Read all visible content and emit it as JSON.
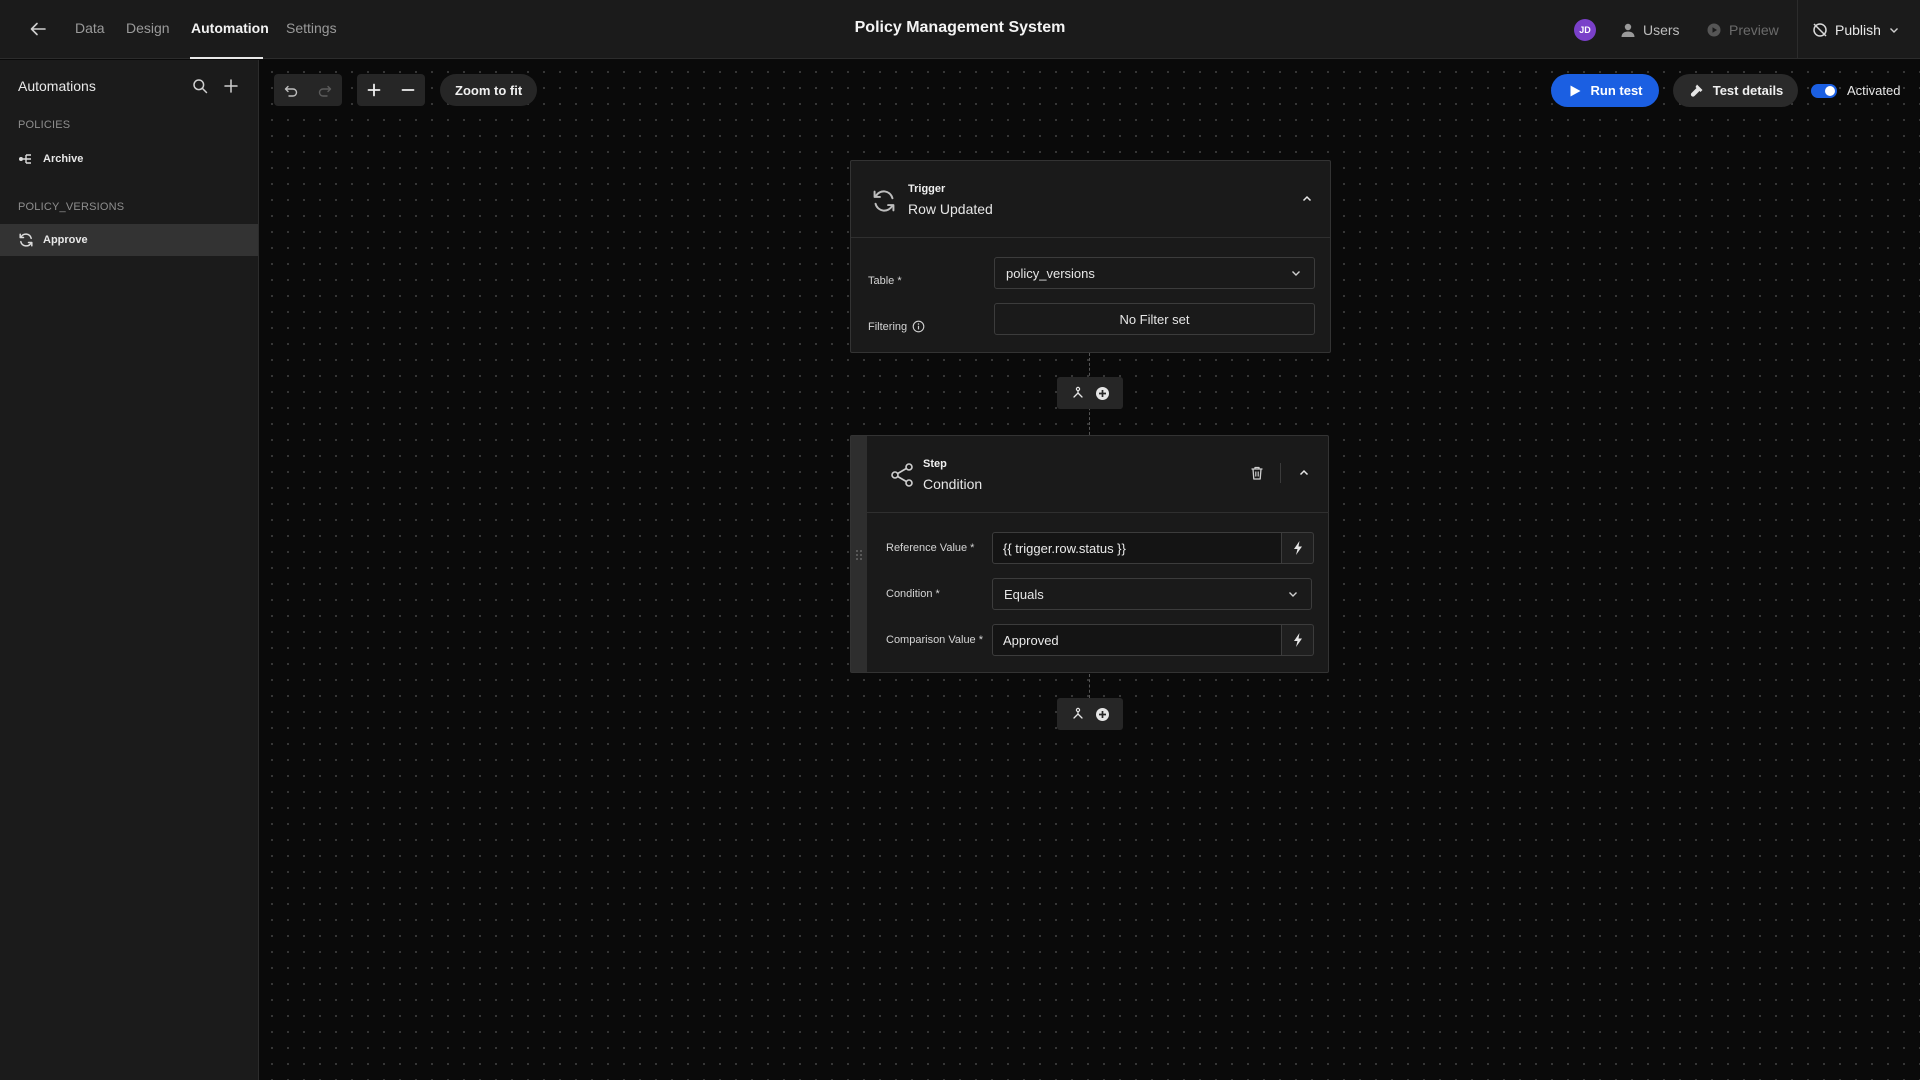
{
  "app": {
    "title": "Policy Management System"
  },
  "nav": {
    "tabs": [
      {
        "label": "Data"
      },
      {
        "label": "Design"
      },
      {
        "label": "Automation"
      },
      {
        "label": "Settings"
      }
    ]
  },
  "topbar": {
    "avatar_initials": "JD",
    "users_label": "Users",
    "preview_label": "Preview",
    "publish_label": "Publish"
  },
  "sidebar": {
    "title": "Automations",
    "sections": [
      {
        "title": "POLICIES",
        "items": [
          {
            "label": "Archive",
            "icon": "branch-icon"
          }
        ]
      },
      {
        "title": "POLICY_VERSIONS",
        "items": [
          {
            "label": "Approve",
            "icon": "refresh-icon"
          }
        ]
      }
    ]
  },
  "toolbar": {
    "zoom_fit_label": "Zoom to fit",
    "run_test_label": "Run test",
    "test_details_label": "Test details",
    "activated_label": "Activated",
    "activated": true
  },
  "trigger": {
    "type_label": "Trigger",
    "name": "Row Updated",
    "table_label": "Table *",
    "table_value": "policy_versions",
    "filtering_label": "Filtering",
    "filter_value": "No Filter set"
  },
  "step": {
    "type_label": "Step",
    "name": "Condition",
    "reference_label": "Reference Value *",
    "reference_value": "{{ trigger.row.status }}",
    "condition_label": "Condition *",
    "condition_value": "Equals",
    "comparison_label": "Comparison Value *",
    "comparison_value": "Approved"
  },
  "colors": {
    "accent": "#1b5fe2",
    "avatar": "#7a40c9",
    "background": "#0a0a0a",
    "panel": "#1b1b1b"
  }
}
